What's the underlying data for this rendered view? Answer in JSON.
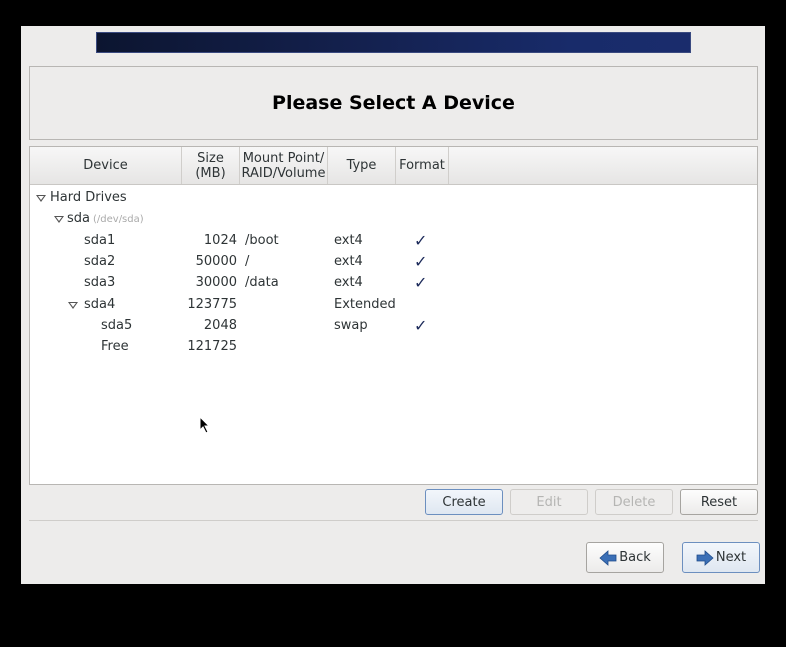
{
  "header": {
    "title": "Please Select A Device"
  },
  "table": {
    "columns": [
      "Device",
      "Size\n(MB)",
      "Mount Point/\nRAID/Volume",
      "Type",
      "Format"
    ],
    "column_lines": [
      [
        "Device"
      ],
      [
        "Size",
        "(MB)"
      ],
      [
        "Mount Point/",
        "RAID/Volume"
      ],
      [
        "Type"
      ],
      [
        "Format"
      ]
    ],
    "rows": [
      {
        "device": "Hard Drives",
        "level": 0,
        "expander": true,
        "size": "",
        "mount": "",
        "type": "",
        "format": false
      },
      {
        "device": "sda",
        "sub": "(/dev/sda)",
        "level": 1,
        "expander": true,
        "size": "",
        "mount": "",
        "type": "",
        "format": false
      },
      {
        "device": "sda1",
        "level": 2,
        "expander": false,
        "size": "1024",
        "mount": "/boot",
        "type": "ext4",
        "format": true
      },
      {
        "device": "sda2",
        "level": 2,
        "expander": false,
        "size": "50000",
        "mount": "/",
        "type": "ext4",
        "format": true
      },
      {
        "device": "sda3",
        "level": 2,
        "expander": false,
        "size": "30000",
        "mount": "/data",
        "type": "ext4",
        "format": true
      },
      {
        "device": "sda4",
        "level": 2,
        "expander": true,
        "size": "123775",
        "mount": "",
        "type": "Extended",
        "format": false
      },
      {
        "device": "sda5",
        "level": 3,
        "expander": false,
        "size": "2048",
        "mount": "",
        "type": "swap",
        "format": true
      },
      {
        "device": "Free",
        "level": 3,
        "expander": false,
        "size": "121725",
        "mount": "",
        "type": "",
        "format": false
      }
    ],
    "check_glyph": "✓"
  },
  "actions": {
    "create": "Create",
    "edit": "Edit",
    "delete": "Delete",
    "reset": "Reset"
  },
  "nav": {
    "back": "Back",
    "next": "Next"
  },
  "colors": {
    "banner": "#14214f",
    "arrow": "#3b6fb6"
  }
}
